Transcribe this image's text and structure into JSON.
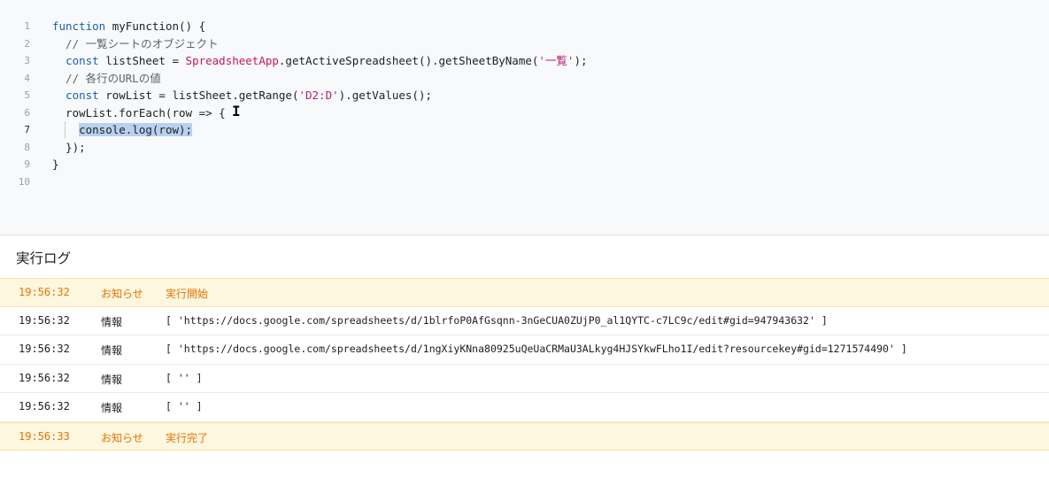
{
  "editor": {
    "lines": [
      {
        "n": "1",
        "segments": [
          {
            "t": "function",
            "c": "kw"
          },
          {
            "t": " myFunction() {",
            "c": ""
          }
        ]
      },
      {
        "n": "2",
        "segments": [
          {
            "t": "  // 一覧シートのオブジェクト",
            "c": "cm"
          }
        ]
      },
      {
        "n": "3",
        "segments": [
          {
            "t": "  ",
            "c": ""
          },
          {
            "t": "const",
            "c": "kw"
          },
          {
            "t": " listSheet = ",
            "c": ""
          },
          {
            "t": "SpreadsheetApp",
            "c": "cls"
          },
          {
            "t": ".getActiveSpreadsheet().getSheetByName(",
            "c": ""
          },
          {
            "t": "'一覧'",
            "c": "str"
          },
          {
            "t": ");",
            "c": ""
          }
        ]
      },
      {
        "n": "4",
        "segments": [
          {
            "t": "  // 各行のURLの値",
            "c": "cm"
          }
        ]
      },
      {
        "n": "5",
        "segments": [
          {
            "t": "  ",
            "c": ""
          },
          {
            "t": "const",
            "c": "kw"
          },
          {
            "t": " rowList = listSheet.getRange(",
            "c": ""
          },
          {
            "t": "'D2:D'",
            "c": "str"
          },
          {
            "t": ").getValues();",
            "c": ""
          }
        ]
      },
      {
        "n": "6",
        "segments": [
          {
            "t": "  rowList.forEach(row => {",
            "c": ""
          }
        ]
      },
      {
        "n": "7",
        "segments": [
          {
            "t": "    ",
            "c": ""
          },
          {
            "t": "console.log(row);",
            "c": "sel"
          }
        ]
      },
      {
        "n": "8",
        "segments": [
          {
            "t": "  });",
            "c": ""
          }
        ]
      },
      {
        "n": "9",
        "segments": [
          {
            "t": "}",
            "c": ""
          }
        ]
      },
      {
        "n": "10",
        "segments": []
      }
    ],
    "active_line": "7"
  },
  "log": {
    "title": "実行ログ",
    "rows": [
      {
        "time": "19:56:32",
        "level": "お知らせ",
        "message": "実行開始",
        "type": "notice"
      },
      {
        "time": "19:56:32",
        "level": "情報",
        "message": "[ 'https://docs.google.com/spreadsheets/d/1blrfoP0AfGsqnn-3nGeCUA0ZUjP0_al1QYTC-c7LC9c/edit#gid=947943632' ]",
        "type": "info"
      },
      {
        "time": "19:56:32",
        "level": "情報",
        "message": "[ 'https://docs.google.com/spreadsheets/d/1ngXiyKNna80925uQeUaCRMaU3ALkyg4HJSYkwFLho1I/edit?resourcekey#gid=1271574490' ]",
        "type": "info"
      },
      {
        "time": "19:56:32",
        "level": "情報",
        "message": "[ '' ]",
        "type": "info"
      },
      {
        "time": "19:56:32",
        "level": "情報",
        "message": "[ '' ]",
        "type": "info"
      },
      {
        "time": "19:56:33",
        "level": "お知らせ",
        "message": "実行完了",
        "type": "notice"
      }
    ]
  },
  "colors": {
    "notice_text": "#e37400",
    "notice_bg": "#fef7e0",
    "keyword": "#1a5fb4",
    "selection": "#b7d1ef"
  }
}
